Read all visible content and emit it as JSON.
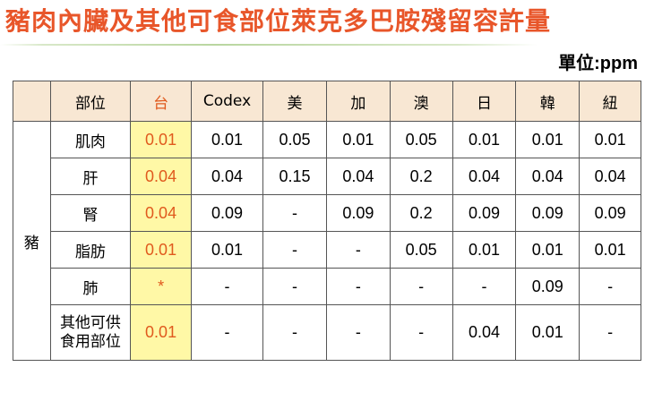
{
  "title": "豬肉內臟及其他可食部位萊克多巴胺殘留容許量",
  "unit_label": "單位:ppm",
  "table": {
    "headers": [
      "部位",
      "台",
      "Codex",
      "美",
      "加",
      "澳",
      "日",
      "韓",
      "紐"
    ],
    "category": "豬",
    "rows": [
      {
        "part": "肌肉",
        "values": [
          "0.01",
          "0.01",
          "0.05",
          "0.01",
          "0.05",
          "0.01",
          "0.01",
          "0.01"
        ]
      },
      {
        "part": "肝",
        "values": [
          "0.04",
          "0.04",
          "0.15",
          "0.04",
          "0.2",
          "0.04",
          "0.04",
          "0.04"
        ]
      },
      {
        "part": "腎",
        "values": [
          "0.04",
          "0.09",
          "-",
          "0.09",
          "0.2",
          "0.09",
          "0.09",
          "0.09"
        ]
      },
      {
        "part": "脂肪",
        "values": [
          "0.01",
          "0.01",
          "-",
          "-",
          "0.05",
          "0.01",
          "0.01",
          "0.01"
        ]
      },
      {
        "part": "肺",
        "values": [
          "*",
          "-",
          "-",
          "-",
          "-",
          "-",
          "0.09",
          "-"
        ]
      },
      {
        "part_line1": "其他可供",
        "part_line2": "食用部位",
        "values": [
          "0.01",
          "-",
          "-",
          "-",
          "-",
          "0.04",
          "0.01",
          "-"
        ]
      }
    ]
  },
  "colors": {
    "title": "#e8562a",
    "header_bg": "#f8e7d3",
    "taiwan_column_bg": "#fff8a6",
    "taiwan_text": "#e05a1e"
  }
}
